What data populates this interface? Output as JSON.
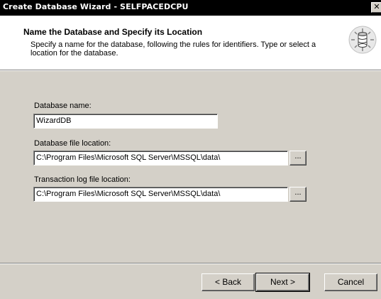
{
  "window": {
    "title": "Create Database Wizard - SELFPACEDCPU",
    "close_glyph": "✕"
  },
  "header": {
    "title": "Name the Database and Specify its Location",
    "subtitle": "Specify a name for the database, following the rules for identifiers. Type or select a location for the database.",
    "icon": "database-wizard-icon"
  },
  "form": {
    "database_name": {
      "label": "Database name:",
      "value": "WizardDB"
    },
    "database_file_location": {
      "label": "Database file location:",
      "value": "C:\\Program Files\\Microsoft SQL Server\\MSSQL\\data\\",
      "browse_label": "..."
    },
    "transaction_log_location": {
      "label": "Transaction log file location:",
      "value": "C:\\Program Files\\Microsoft SQL Server\\MSSQL\\data\\",
      "browse_label": "..."
    }
  },
  "buttons": {
    "back": "< Back",
    "next": "Next >",
    "cancel": "Cancel"
  },
  "colors": {
    "dialog_face": "#d4d0c8",
    "title_bar": "#000000",
    "header_background": "#ffffff"
  }
}
